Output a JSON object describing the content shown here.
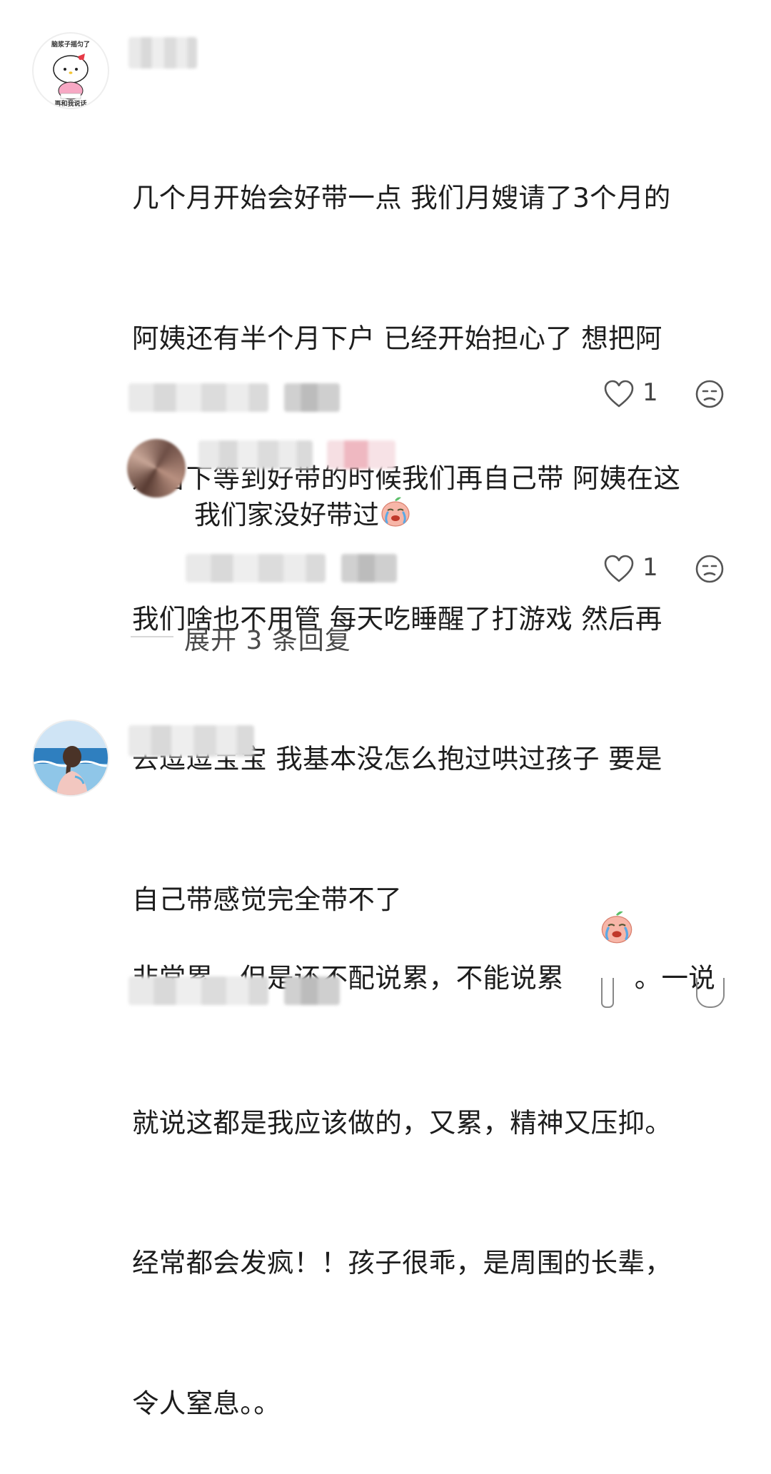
{
  "comments": [
    {
      "avatar_caption_top": "脑浆子摇匀了",
      "avatar_caption_bottom": "再和我说话",
      "lines": [
        "几个月开始会好带一点 我们月嫂请了3个月的",
        "阿姨还有半个月下户 已经开始担心了 想把阿",
        "姨留下等到好带的时候我们再自己带 阿姨在这",
        "我们啥也不用管 每天吃睡醒了打游戏 然后再",
        "去逗逗宝宝 我基本没怎么抱过哄过孩子 要是",
        "自己带感觉完全带不了"
      ],
      "likes": "1",
      "reply": {
        "text": "我们家没好带过",
        "likes": "1"
      },
      "expand_label": "展开 3 条回复"
    },
    {
      "lines": [
        "非常累，但是还不配说累，不能说累",
        "就说这都是我应该做的，又累，精神又压抑。",
        "经常都会发疯！！孩子很乖，是周围的长辈，",
        "令人窒息。。"
      ],
      "line1_suffix": "。一说"
    }
  ],
  "icons": {
    "like": "heart-outline-icon",
    "dislike": "unamused-face-icon",
    "emoji": "crying-peach-emoji"
  },
  "colors": {
    "text": "#1d1d1d",
    "secondary": "#4a4a4a",
    "icon": "#555555"
  }
}
